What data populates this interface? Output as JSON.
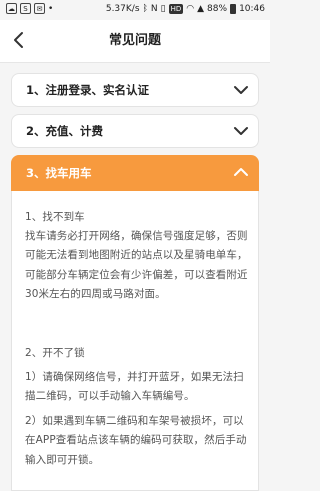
{
  "status_bar": {
    "network_speed": "5.37K/s",
    "hd": "HD",
    "battery": "88%",
    "time": "10:46"
  },
  "nav": {
    "title": "常见问题"
  },
  "sections": [
    {
      "label": "1、注册登录、实名认证"
    },
    {
      "label": "2、充值、计费"
    },
    {
      "label": "3、找车用车"
    }
  ],
  "content": {
    "p1": "1、找不到车",
    "p2": "找车请务必打开网络，确保信号强度足够，否则可能无法看到地图附近的站点以及星骑电单车，可能部分车辆定位会有少许偏差，可以查看附近30米左右的四周或马路对面。",
    "p3": "2、开不了锁",
    "p4": "1）请确保网络信号，并打开蓝牙，如果无法扫描二维码，可以手动输入车辆编号。",
    "p5": "2）如果遇到车辆二维码和车架号被损坏，可以在APP查看站点该车辆的编码可获取，然后手动输入即可开锁。"
  }
}
